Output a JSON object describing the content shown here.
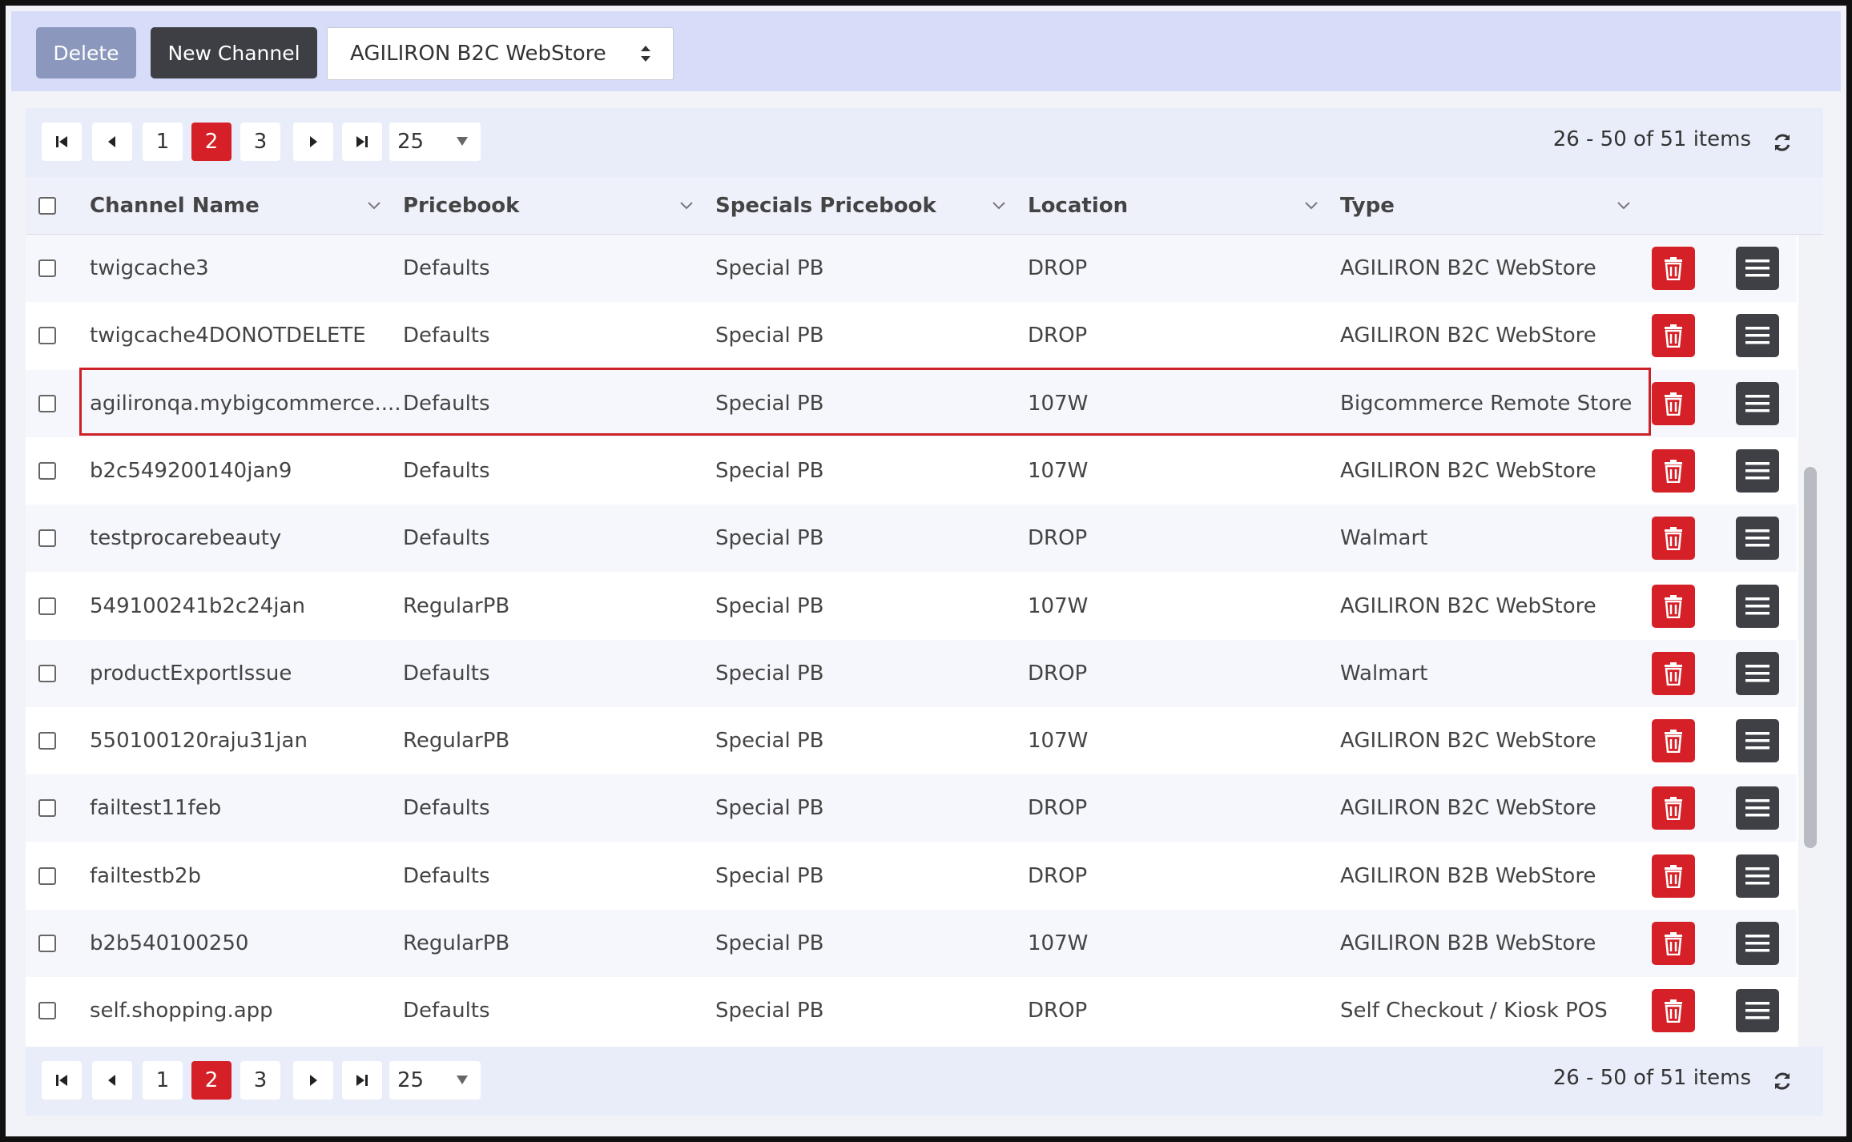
{
  "toolbar": {
    "delete_label": "Delete",
    "new_channel_label": "New Channel",
    "channel_type_selected": "AGILIRON B2C WebStore"
  },
  "pager": {
    "pages": [
      "1",
      "2",
      "3"
    ],
    "active_page": "2",
    "page_size": "25",
    "info": "26 - 50 of 51 items"
  },
  "columns": {
    "channel_name": "Channel Name",
    "pricebook": "Pricebook",
    "specials_pricebook": "Specials Pricebook",
    "location": "Location",
    "type": "Type"
  },
  "rows": [
    {
      "name": "twigcache3",
      "pricebook": "Defaults",
      "specials": "Special PB",
      "location": "DROP",
      "type": "AGILIRON B2C WebStore"
    },
    {
      "name": "twigcache4DONOTDELETE",
      "pricebook": "Defaults",
      "specials": "Special PB",
      "location": "DROP",
      "type": "AGILIRON B2C WebStore"
    },
    {
      "name": "agilironqa.mybigcommerce....",
      "pricebook": "Defaults",
      "specials": "Special PB",
      "location": "107W",
      "type": "Bigcommerce Remote Store"
    },
    {
      "name": "b2c549200140jan9",
      "pricebook": "Defaults",
      "specials": "Special PB",
      "location": "107W",
      "type": "AGILIRON B2C WebStore"
    },
    {
      "name": "testprocarebeauty",
      "pricebook": "Defaults",
      "specials": "Special PB",
      "location": "DROP",
      "type": "Walmart"
    },
    {
      "name": "549100241b2c24jan",
      "pricebook": "RegularPB",
      "specials": "Special PB",
      "location": "107W",
      "type": "AGILIRON B2C WebStore"
    },
    {
      "name": "productExportIssue",
      "pricebook": "Defaults",
      "specials": "Special PB",
      "location": "DROP",
      "type": "Walmart"
    },
    {
      "name": "550100120raju31jan",
      "pricebook": "RegularPB",
      "specials": "Special PB",
      "location": "107W",
      "type": "AGILIRON B2C WebStore"
    },
    {
      "name": "failtest11feb",
      "pricebook": "Defaults",
      "specials": "Special PB",
      "location": "DROP",
      "type": "AGILIRON B2C WebStore"
    },
    {
      "name": "failtestb2b",
      "pricebook": "Defaults",
      "specials": "Special PB",
      "location": "DROP",
      "type": "AGILIRON B2B WebStore"
    },
    {
      "name": "b2b540100250",
      "pricebook": "RegularPB",
      "specials": "Special PB",
      "location": "107W",
      "type": "AGILIRON B2B WebStore"
    },
    {
      "name": "self.shopping.app",
      "pricebook": "Defaults",
      "specials": "Special PB",
      "location": "DROP",
      "type": "Self Checkout / Kiosk POS"
    }
  ]
}
